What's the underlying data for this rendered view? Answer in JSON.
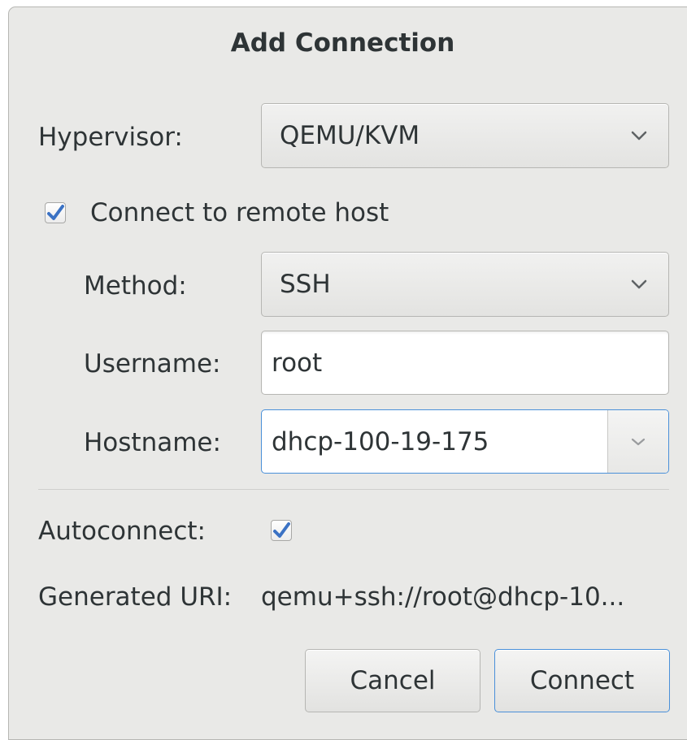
{
  "dialog": {
    "title": "Add Connection"
  },
  "hypervisor": {
    "label": "Hypervisor:",
    "value": "QEMU/KVM"
  },
  "remote": {
    "label": "Connect to remote host",
    "checked": true
  },
  "method": {
    "label": "Method:",
    "value": "SSH"
  },
  "username": {
    "label": "Username:",
    "value": "root"
  },
  "hostname": {
    "label": "Hostname:",
    "value": "dhcp-100-19-175"
  },
  "autoconnect": {
    "label": "Autoconnect:",
    "checked": true
  },
  "uri": {
    "label": "Generated URI:",
    "value": "qemu+ssh://root@dhcp-10..."
  },
  "buttons": {
    "cancel_label": "Cancel",
    "connect_label": "Connect"
  },
  "icons": {
    "dropdown": "chevron-down-icon",
    "check": "checkmark-icon"
  },
  "colors": {
    "accent": "#4a90d9",
    "check": "#3b72c4"
  }
}
